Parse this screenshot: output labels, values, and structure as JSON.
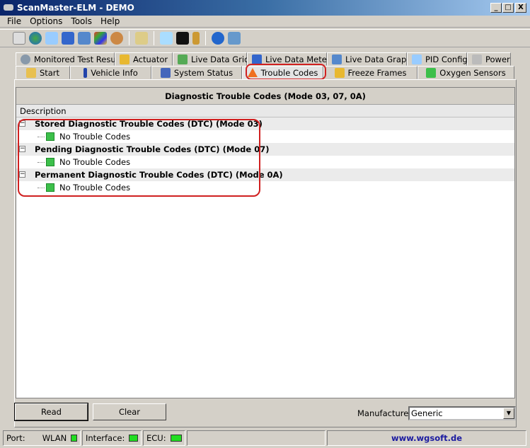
{
  "window": {
    "title": "ScanMaster-ELM - DEMO",
    "min": "_",
    "max": "□",
    "close": "X"
  },
  "menu": [
    "File",
    "Options",
    "Tools",
    "Help"
  ],
  "toolbar": {
    "icons": [
      "connect",
      "world",
      "pid-doc",
      "grid",
      "graph",
      "windows-flag",
      "person",
      "clipboard",
      "search-window",
      "terminal",
      "battery",
      "info",
      "exit"
    ]
  },
  "tabs_row1": [
    "Monitored Test Results",
    "Actuator",
    "Live Data Grid",
    "Live Data Meter",
    "Live Data Graph",
    "PID Config",
    "Power"
  ],
  "tabs_row2": [
    "Start",
    "Vehicle Info",
    "System Status",
    "Trouble Codes",
    "Freeze Frames",
    "Oxygen Sensors"
  ],
  "active_tab": "Trouble Codes",
  "panel": {
    "title": "Diagnostic Trouble Codes (Mode 03, 07, 0A)",
    "column": "Description",
    "groups": [
      {
        "label": "Stored Diagnostic Trouble Codes (DTC) (Mode 03)",
        "item": "No Trouble Codes"
      },
      {
        "label": "Pending Diagnostic Trouble Codes (DTC) (Mode 07)",
        "item": "No Trouble Codes"
      },
      {
        "label": "Permanent Diagnostic Trouble Codes (DTC) (Mode 0A)",
        "item": "No Trouble Codes"
      }
    ]
  },
  "buttons": {
    "read": "Read",
    "clear": "Clear"
  },
  "manufacturer": {
    "label": "Manufacturer",
    "value": "Generic"
  },
  "status": {
    "port": "Port:",
    "wlan": "WLAN",
    "interface": "Interface:",
    "ecu": "ECU:",
    "link": "www.wgsoft.de",
    "led_color": "#22dd22"
  },
  "highlight_color": "#d02020"
}
